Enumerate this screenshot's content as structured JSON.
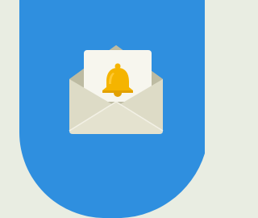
{
  "illustration": {
    "icon": "envelope-notification-bell",
    "colors": {
      "page_background": "#e9ede2",
      "banner": "#2f8fdf",
      "envelope_back": "#c8c6ad",
      "envelope_inside_shadow": "#bdbba2",
      "envelope_front": "#ebe9d8",
      "envelope_fold_dark": "#dddbc6",
      "envelope_fold_light": "#e4e2cf",
      "envelope_fold_lines": "#f3f1e6",
      "letter": "#f7f6ee",
      "bell": "#f5b400",
      "bell_highlight": "#ffc933",
      "bell_shadow": "#e2a100"
    }
  }
}
